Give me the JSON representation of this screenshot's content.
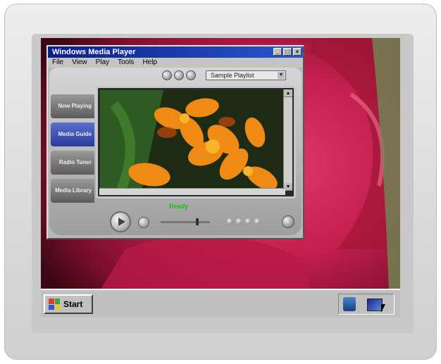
{
  "player": {
    "title": "Windows Media Player",
    "menu": [
      "File",
      "View",
      "Play",
      "Tools",
      "Help"
    ],
    "playlist": "Sample Playlist",
    "sidebar": [
      "Now Playing",
      "Media Guide",
      "Radio Tuner",
      "Media Library"
    ],
    "status": "Ready",
    "seek_progress": 0.75
  },
  "taskbar": {
    "start_label": "Start"
  },
  "colors": {
    "title_start": "#0a1f8a",
    "title_end": "#2c56c8",
    "status_green": "#16c016",
    "taskbar": "#c0c0c0"
  },
  "icons": {
    "tray_1": "media-player-icon",
    "tray_2": "display-icon",
    "start": "windows-logo-icon"
  }
}
